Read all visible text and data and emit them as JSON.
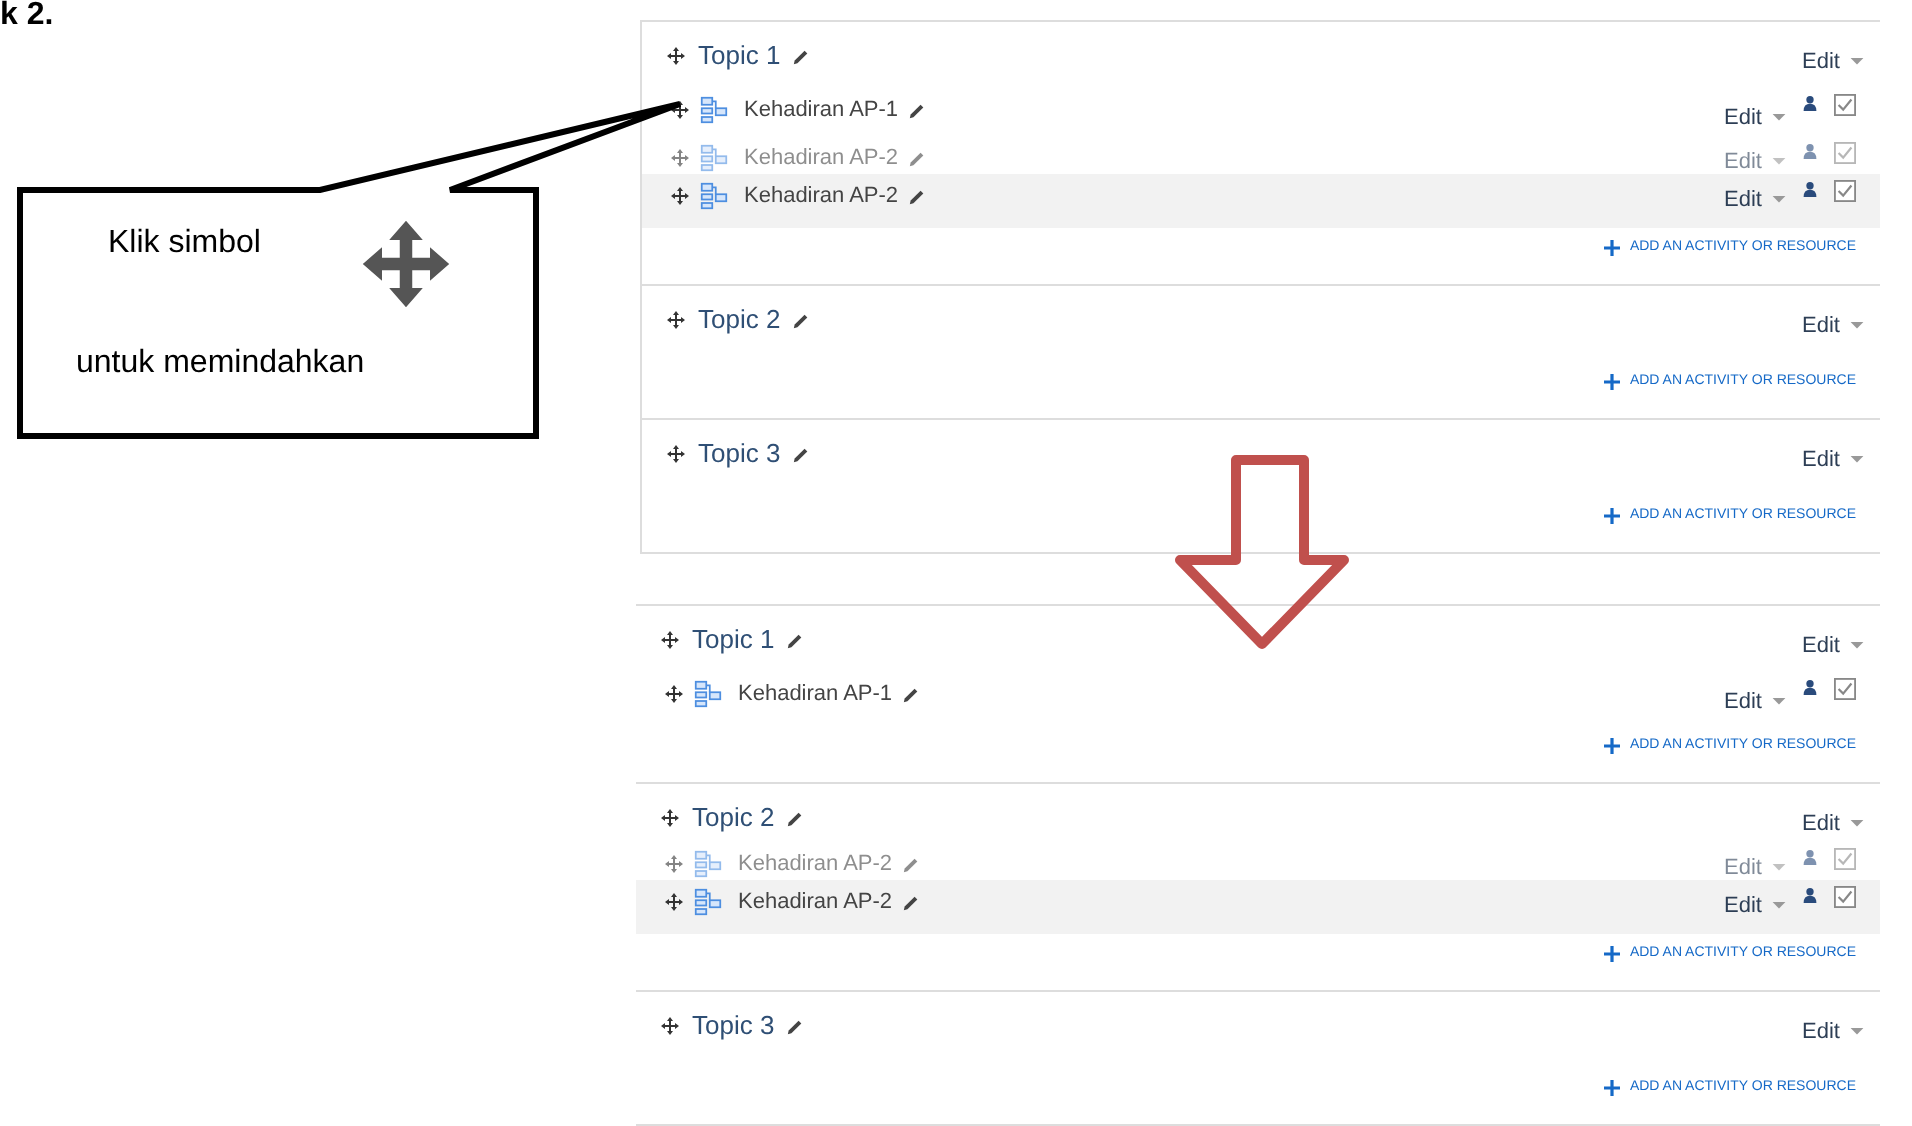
{
  "heading": "k 2.",
  "callout": {
    "lines": [
      "Klik simbol",
      "untuk memindahkan"
    ]
  },
  "panels": [
    {
      "sections": [
        {
          "title": "Topic 1",
          "edit": "Edit",
          "add": "ADD AN ACTIVITY OR RESOURCE",
          "activities": [
            {
              "kind": "normal",
              "name": "Kehadiran AP-1",
              "edit": "Edit"
            },
            {
              "kind": "ghost",
              "name": "Kehadiran AP-2",
              "edit": "Edit"
            },
            {
              "kind": "dragging",
              "name": "Kehadiran AP-2",
              "edit": "Edit"
            }
          ]
        },
        {
          "title": "Topic 2",
          "edit": "Edit",
          "add": "ADD AN ACTIVITY OR RESOURCE"
        },
        {
          "title": "Topic 3",
          "edit": "Edit",
          "add": "ADD AN ACTIVITY OR RESOURCE"
        }
      ]
    },
    {
      "sections": [
        {
          "title": "Topic 1",
          "edit": "Edit",
          "add": "ADD AN ACTIVITY OR RESOURCE",
          "activities": [
            {
              "kind": "normal",
              "name": "Kehadiran AP-1",
              "edit": "Edit"
            }
          ]
        },
        {
          "title": "Topic 2",
          "edit": "Edit",
          "add": "ADD AN ACTIVITY OR RESOURCE",
          "activities": [
            {
              "kind": "ghost",
              "name": "Kehadiran AP-2",
              "edit": "Edit"
            },
            {
              "kind": "dragging",
              "name": "Kehadiran AP-2",
              "edit": "Edit"
            }
          ]
        },
        {
          "title": "Topic 3",
          "edit": "Edit",
          "add": "ADD AN ACTIVITY OR RESOURCE"
        }
      ]
    }
  ]
}
